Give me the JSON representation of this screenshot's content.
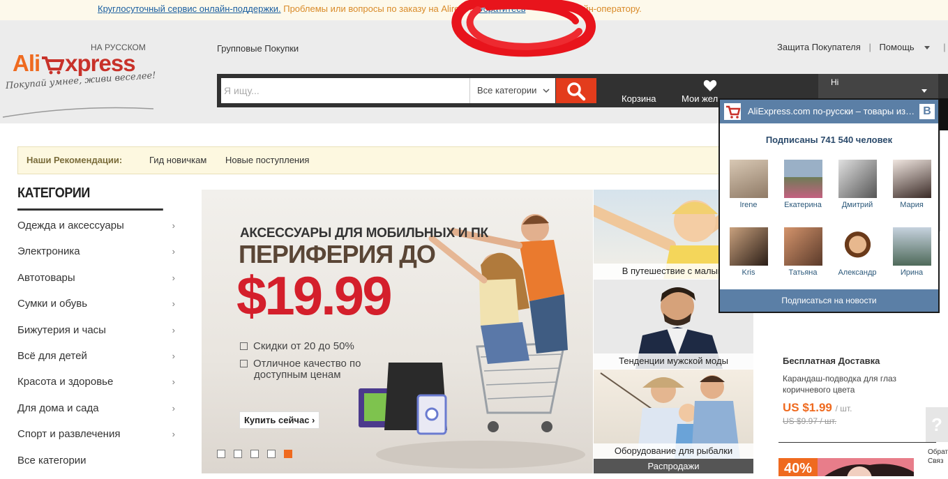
{
  "notice": {
    "support_link": "Круглосуточный сервис онлайн-поддержки.",
    "text_before": "Проблемы или вопросы по заказу на Ali",
    "text_middle": "ress?",
    "contact_link": "Обратитесь",
    "text_after": "онлайн-оператору."
  },
  "header": {
    "logo_ru": "НА РУССКОМ",
    "logo_ali": "Ali",
    "logo_xpress": "xpress",
    "slogan": "Покупай умнее, живи веселее!",
    "group_buy": "Групповые Покупки",
    "buyer_protection": "Защита Покупателя",
    "help": "Помощь",
    "sep": "|"
  },
  "search": {
    "placeholder": "Я ищу...",
    "category": "Все категории"
  },
  "nav": {
    "cart": "Корзина",
    "wishlist": "Мои жел",
    "user_greeting": "Hi"
  },
  "recommend": {
    "title": "Наши Рекомендации:",
    "guide": "Гид новичкам",
    "new_arrivals": "Новые поступления"
  },
  "categories": {
    "title": "КАТЕГОРИИ",
    "items": [
      {
        "label": "Одежда и аксессуары"
      },
      {
        "label": "Электроника"
      },
      {
        "label": "Автотовары"
      },
      {
        "label": "Сумки и обувь"
      },
      {
        "label": "Бижутерия и часы"
      },
      {
        "label": "Всё для детей"
      },
      {
        "label": "Красота и здоровье"
      },
      {
        "label": "Для дома и сада"
      },
      {
        "label": "Спорт и развлечения"
      },
      {
        "label": "Все категории"
      }
    ],
    "arrow": "›"
  },
  "banner": {
    "line1": "АКСЕССУАРЫ ДЛЯ МОБИЛЬНЫХ И ПК",
    "line2": "ПЕРИФЕРИЯ ДО",
    "price": "$19.99",
    "bullet1": "Скидки от 20 до 50%",
    "bullet2a": "Отличное качество по",
    "bullet2b": "доступным ценам",
    "cta": "Купить сейчас ›",
    "slide_count": 5,
    "active_slide": 5
  },
  "tiles": [
    {
      "caption": "В путешествие с малыш"
    },
    {
      "caption": "Тенденции мужской моды"
    },
    {
      "caption": "Оборудование для рыбалки"
    }
  ],
  "sale_bar": "Распродажи",
  "vk": {
    "header": "AliExpress.com по-русски – товары из Китая",
    "logo": "В",
    "subscribers": "Подписаны 741 540 человек",
    "people": [
      "Irene",
      "Екатерина",
      "Дмитрий",
      "Мария",
      "Kris",
      "Татьяна",
      "Александр",
      "Ирина"
    ],
    "subscribe": "Подписаться на новости"
  },
  "deal": {
    "heading": "Бесплатная Доставка",
    "desc": "Карандаш-подводка для глаз коричневого цвета",
    "price": "US $1.99",
    "unit": "/ шт.",
    "old_price": "US $9.97 / шт."
  },
  "promo_pct": "40%",
  "help_widget": {
    "icon": "?",
    "label1": "Обрат",
    "label2": "Связ"
  },
  "colors": {
    "accent": "#ef6a1f",
    "brand_red": "#c8322a",
    "search_btn": "#e33c1c",
    "vk_blue": "#5b7fa6"
  }
}
